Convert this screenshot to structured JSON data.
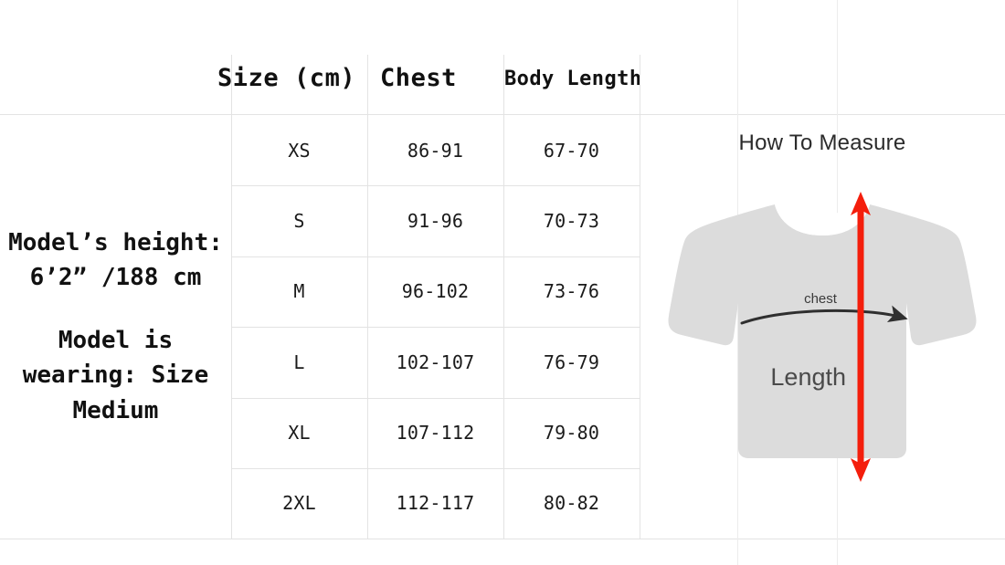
{
  "table": {
    "headers": {
      "size": "Size (cm)",
      "chest": "Chest",
      "body_length": "Body Length"
    },
    "rows": [
      {
        "size": "XS",
        "chest": "86-91",
        "body_length": "67-70"
      },
      {
        "size": "S",
        "chest": "91-96",
        "body_length": "70-73"
      },
      {
        "size": "M",
        "chest": "96-102",
        "body_length": "73-76"
      },
      {
        "size": "L",
        "chest": "102-107",
        "body_length": "76-79"
      },
      {
        "size": "XL",
        "chest": "107-112",
        "body_length": "79-80"
      },
      {
        "size": "2XL",
        "chest": "112-117",
        "body_length": "80-82"
      }
    ]
  },
  "model_info": {
    "height_note": "Model’s height: 6’2” /188 cm",
    "wearing_note": "Model is wearing: Size Medium"
  },
  "measure": {
    "title": "How To Measure",
    "chest_label": "chest",
    "length_label": "Length"
  },
  "colors": {
    "shirt_fill": "#dcdcdc",
    "arrow_red": "#f41e0c",
    "arc_black": "#2f2f2f",
    "gridline": "#e3e3e3",
    "text": "#1a1a1a"
  }
}
